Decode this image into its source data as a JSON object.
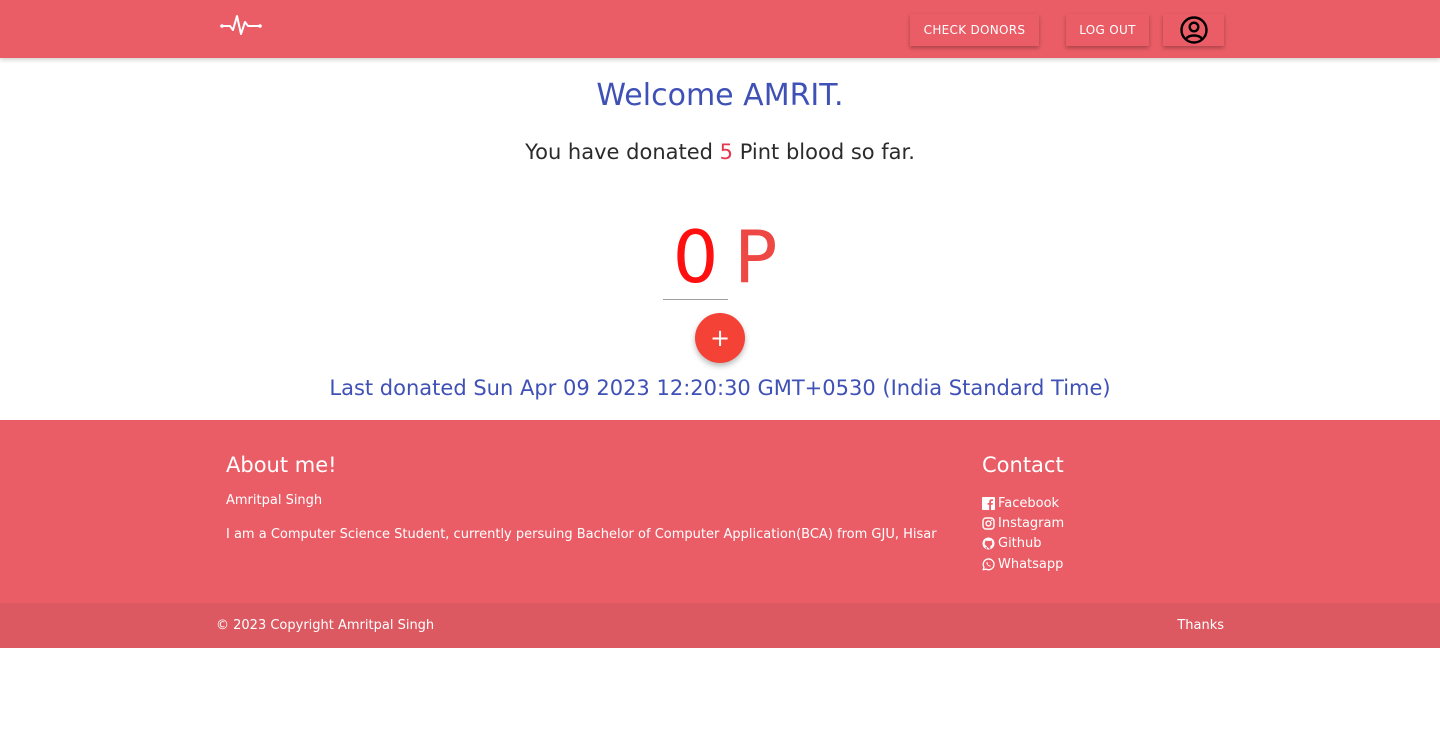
{
  "nav": {
    "logo_icon": "heartbeat-icon",
    "check_donors_label": "CHECK DONORS",
    "logout_label": "LOG OUT",
    "profile_icon": "account-circle-icon"
  },
  "main": {
    "welcome": "Welcome AMRIT.",
    "donated_prefix": "You have donated ",
    "donated_count": "5",
    "donated_suffix": " Pint blood so far.",
    "pint_value": "0",
    "pint_unit": "P",
    "add_label": "+",
    "last_donated": "Last donated Sun Apr 09 2023 12:20:30 GMT+0530 (India Standard Time)"
  },
  "footer": {
    "about_title": "About me!",
    "about_name": "Amritpal Singh",
    "about_desc": "I am a Computer Science Student, currently persuing Bachelor of Computer Application(BCA) from GJU, Hisar",
    "contact_title": "Contact",
    "contacts": [
      {
        "label": "Facebook",
        "icon": "facebook-icon"
      },
      {
        "label": "Instagram",
        "icon": "instagram-icon"
      },
      {
        "label": "Github",
        "icon": "github-icon"
      },
      {
        "label": "Whatsapp",
        "icon": "whatsapp-icon"
      }
    ],
    "copyright": "© 2023 Copyright Amritpal Singh",
    "thanks": "Thanks"
  },
  "colors": {
    "navbar": "#ea5d66",
    "heading_blue": "#3f51b5",
    "pint_red": "#ff1010",
    "fab_red": "#f44336"
  }
}
